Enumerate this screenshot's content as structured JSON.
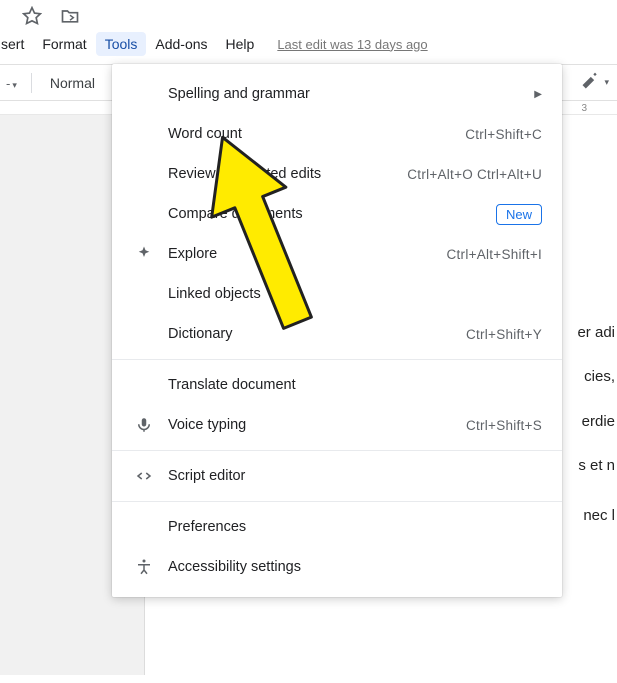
{
  "shortcuts": {
    "star_title": "Star",
    "move_title": "Move"
  },
  "menubar": {
    "items": [
      "sert",
      "Format",
      "Tools",
      "Add-ons",
      "Help"
    ],
    "active_index": 2,
    "last_edit": "Last edit was 13 days ago"
  },
  "toolbar": {
    "style": "Normal"
  },
  "ruler": {
    "tick3": "3"
  },
  "dropdown": {
    "items": [
      {
        "label": "Spelling and grammar",
        "shortcut": "",
        "submenu": true
      },
      {
        "label": "Word count",
        "shortcut": "Ctrl+Shift+C"
      },
      {
        "label": "Review suggested edits",
        "shortcut": "Ctrl+Alt+O Ctrl+Alt+U"
      },
      {
        "label": "Compare documents",
        "shortcut": "",
        "new_badge": "New"
      },
      {
        "label": "Explore",
        "shortcut": "Ctrl+Alt+Shift+I",
        "icon": "explore"
      },
      {
        "label": "Linked objects"
      },
      {
        "label": "Dictionary",
        "shortcut": "Ctrl+Shift+Y"
      }
    ],
    "group2": [
      {
        "label": "Translate document"
      },
      {
        "label": "Voice typing",
        "shortcut": "Ctrl+Shift+S",
        "icon": "mic"
      }
    ],
    "group3": [
      {
        "label": "Script editor",
        "icon": "code"
      }
    ],
    "group4": [
      {
        "label": "Preferences"
      },
      {
        "label": "Accessibility settings",
        "icon": "accessibility"
      }
    ]
  },
  "doc_text": {
    "l1": "er adi",
    "l2": "cies,",
    "l3": "erdie",
    "l4": "s et n",
    "l5": "nec l"
  }
}
